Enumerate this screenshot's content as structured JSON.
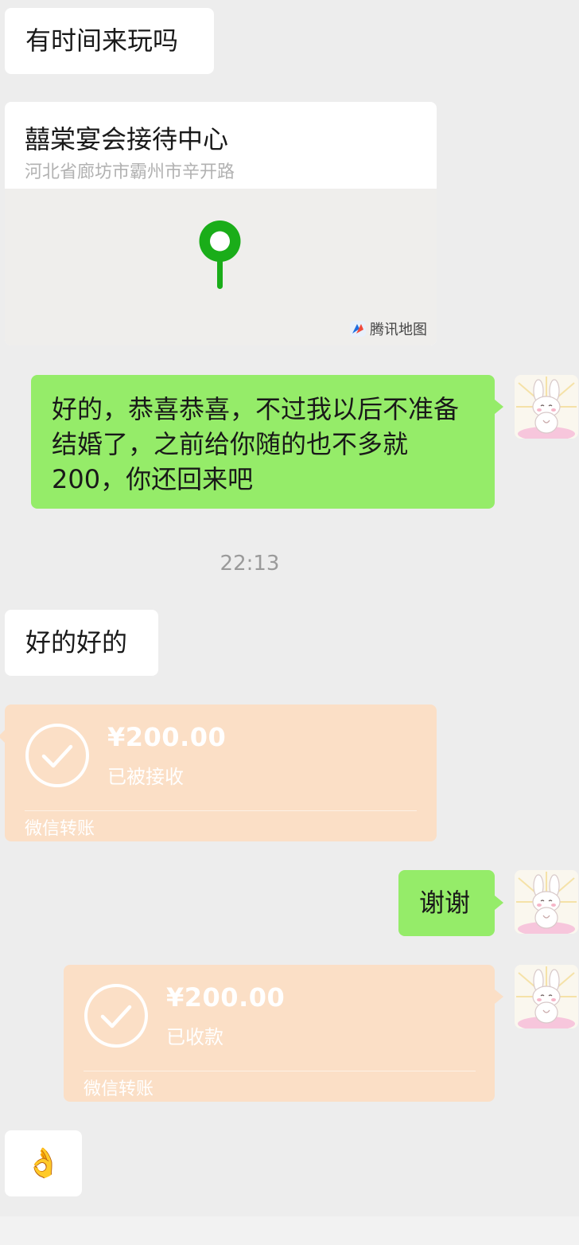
{
  "messages": {
    "m1": "有时间来玩吗",
    "location": {
      "title": "囍棠宴会接待中心",
      "address": "河北省廊坊市霸州市辛开路",
      "map_provider": "腾讯地图"
    },
    "m3": "好的，恭喜恭喜，不过我以后不准备结婚了，之前给你随的也不多就200，你还回来吧",
    "timestamp": "22:13",
    "m4": "好的好的",
    "transfer1": {
      "amount": "¥200.00",
      "status": "已被接收",
      "brand": "微信转账"
    },
    "m5": "谢谢",
    "transfer2": {
      "amount": "¥200.00",
      "status": "已收款",
      "brand": "微信转账"
    },
    "m6": "👌"
  },
  "colors": {
    "background": "#ededed",
    "sent_bubble": "#95ec69",
    "received_bubble": "#ffffff",
    "transfer_card": "#fbdfc6",
    "pin_green": "#1aad19"
  },
  "icons": {
    "pin": "location-pin-icon",
    "check": "check-circle-icon",
    "avatar": "bunny-avatar",
    "tencent": "tencent-map-logo-icon"
  }
}
